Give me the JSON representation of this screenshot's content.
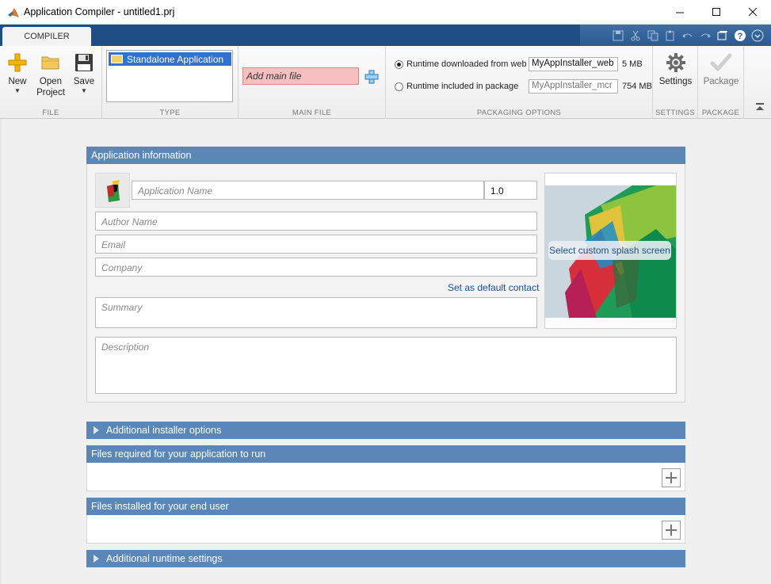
{
  "window": {
    "title": "Application Compiler - untitled1.prj",
    "controls": [
      "minimize-icon",
      "maximize-icon",
      "close-icon"
    ]
  },
  "tabs": {
    "active": "COMPILER"
  },
  "quick_access": {
    "icons": [
      "save-icon",
      "cut-icon",
      "copy-icon",
      "paste-icon",
      "undo-icon",
      "redo-icon",
      "window-layout-icon",
      "help-icon",
      "expand-icon"
    ]
  },
  "ribbon": {
    "file": {
      "label": "FILE",
      "new_label": "New",
      "open_label_1": "Open",
      "open_label_2": "Project",
      "save_label": "Save"
    },
    "type": {
      "label": "TYPE",
      "selected": "Standalone Application"
    },
    "main_file": {
      "label": "MAIN FILE",
      "placeholder": "Add main file"
    },
    "packaging": {
      "label": "PACKAGING OPTIONS",
      "option1_label": "Runtime downloaded from web",
      "option1_value": "MyAppInstaller_web",
      "option1_size": "5 MB",
      "option2_label": "Runtime included in package",
      "option2_value": "MyAppInstaller_mcr",
      "option2_size": "754 MB",
      "selected": "option1"
    },
    "settings": {
      "label": "SETTINGS",
      "button": "Settings"
    },
    "package": {
      "label": "PACKAGE",
      "button": "Package"
    }
  },
  "app_info": {
    "header": "Application information",
    "name_placeholder": "Application Name",
    "version": "1.0",
    "author_placeholder": "Author Name",
    "email_placeholder": "Email",
    "company_placeholder": "Company",
    "default_contact_link": "Set as default contact",
    "summary_placeholder": "Summary",
    "description_placeholder": "Description",
    "splash_button": "Select custom splash screen"
  },
  "sections": {
    "installer_options": "Additional installer options",
    "files_required": "Files required for your application to run",
    "files_installed": "Files installed for your end user",
    "runtime_settings": "Additional runtime settings"
  },
  "colors": {
    "title_bar": "#ffffff",
    "tab_strip": "#1d4e86",
    "panel_header": "#5b87b8",
    "main_file_bg": "#f7c0c0",
    "selection": "#2e73d3"
  }
}
